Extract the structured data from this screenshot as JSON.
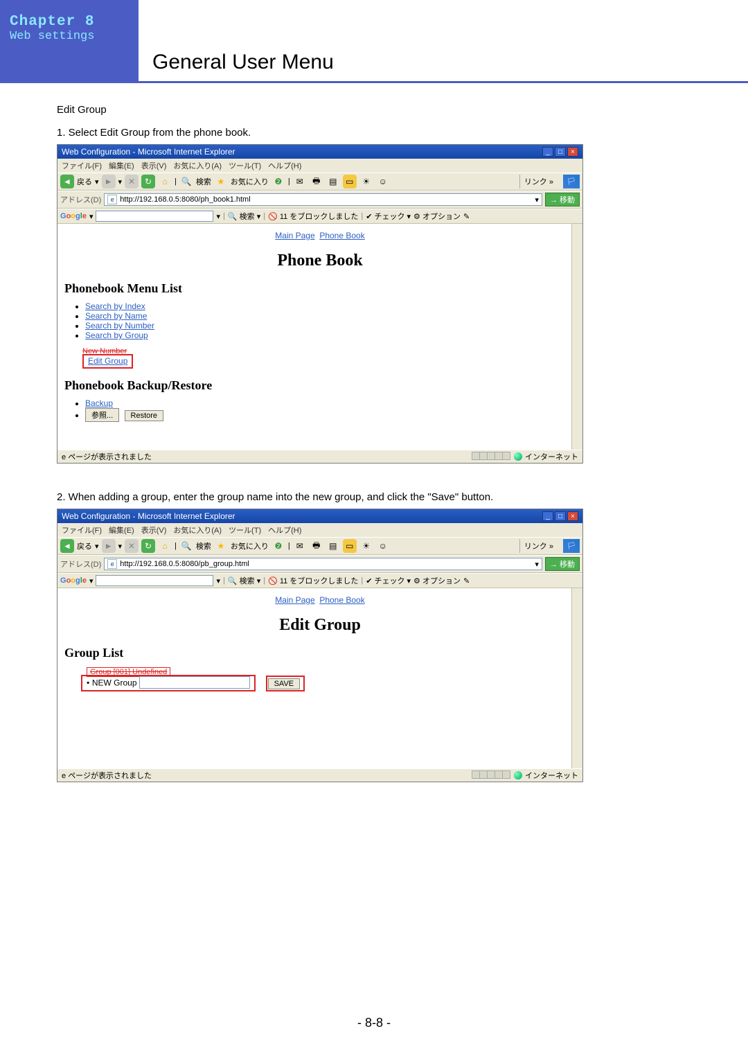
{
  "header": {
    "chapter": "Chapter 8",
    "subhead": "Web settings",
    "pageTitle": "General User Menu"
  },
  "text": {
    "editGroup": "Edit Group",
    "step1": "1. Select  Edit Group from the phone book.",
    "step2": "2. When adding a group, enter the group name into the new group, and click the \"Save\" button."
  },
  "shot1": {
    "winTitle": "Web Configuration - Microsoft Internet Explorer",
    "menu": [
      "ファイル(F)",
      "編集(E)",
      "表示(V)",
      "お気に入り(A)",
      "ツール(T)",
      "ヘルプ(H)"
    ],
    "tb": {
      "back": "戻る",
      "search": "検索",
      "fav": "お気に入り",
      "links": "リンク"
    },
    "addrLbl": "アドレス(D)",
    "addr": "http://192.168.0.5:8080/ph_book1.html",
    "go": "移動",
    "gbar": {
      "search": "検索",
      "blocked": "11 をブロックしました",
      "check": "チェック",
      "option": "オプション"
    },
    "crumb": {
      "main": "Main Page",
      "pb": "Phone Book"
    },
    "heading": "Phone Book",
    "menuList": "Phonebook Menu List",
    "items": [
      "Search by Index",
      "Search by Name",
      "Search by Number",
      "Search by Group"
    ],
    "newNumber": "New Number",
    "editGroup": "Edit Group",
    "backup": "Phonebook Backup/Restore",
    "backupLink": "Backup",
    "browse": "参照...",
    "restore": "Restore",
    "statusL": "ページが表示されました",
    "statusR": "インターネット"
  },
  "shot2": {
    "winTitle": "Web Configuration - Microsoft Internet Explorer",
    "addr": "http://192.168.0.5:8080/pb_group.html",
    "heading": "Edit Group",
    "groupList": "Group List",
    "struck": "Group [001] Undefined",
    "newGroup": "NEW Group",
    "save": "SAVE",
    "statusL": "ページが表示されました",
    "statusR": "インターネット"
  },
  "footer": {
    "pageNum": "- 8-8 -"
  }
}
